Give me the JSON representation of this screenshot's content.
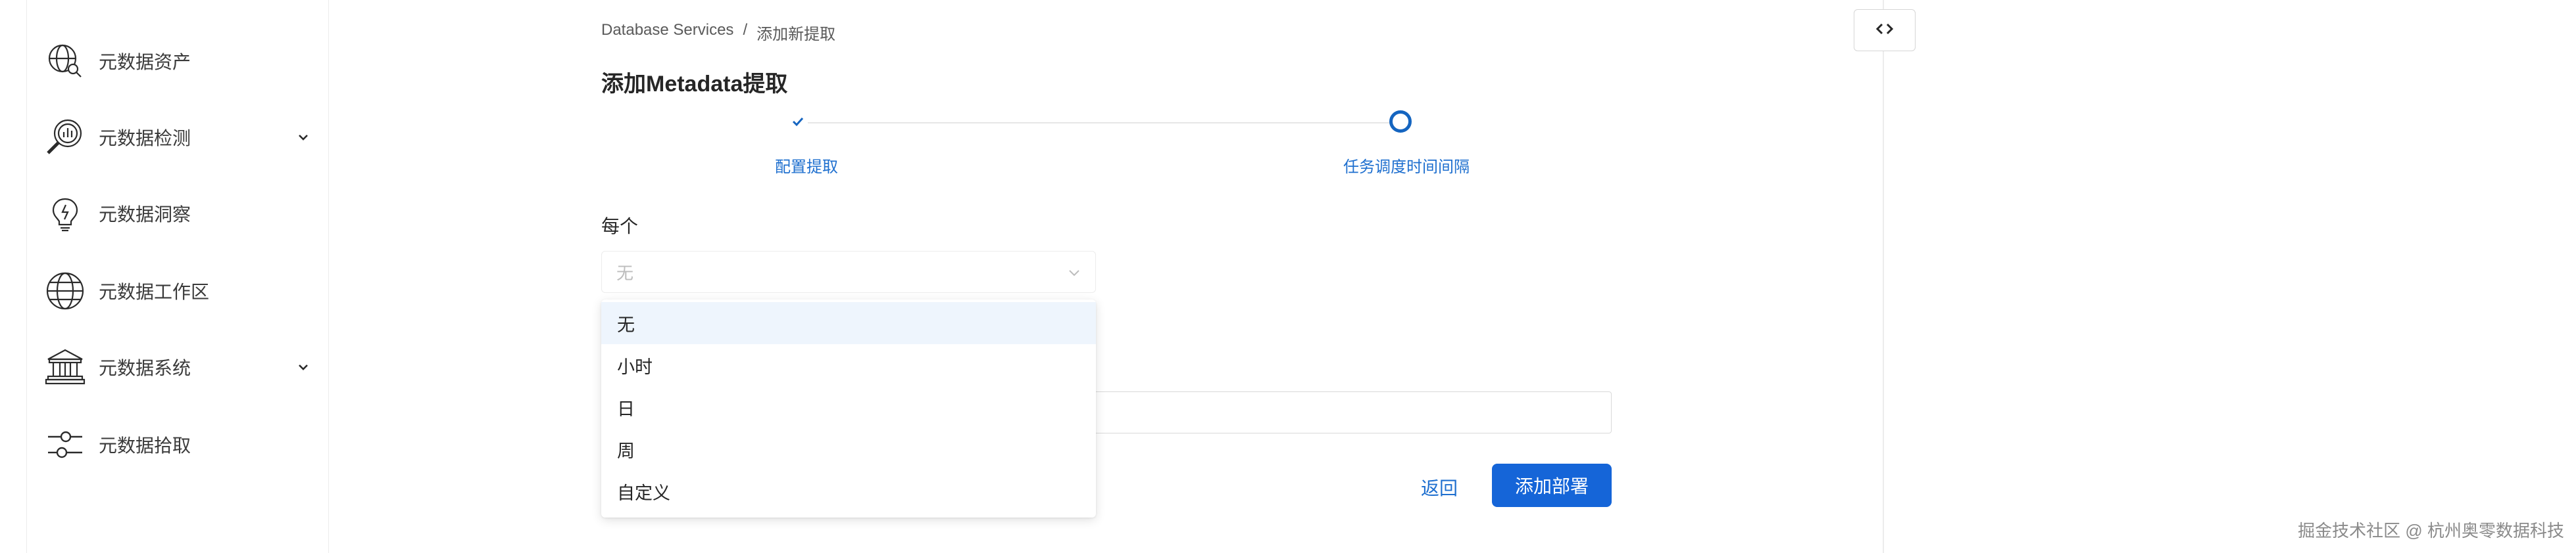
{
  "sidebar": {
    "items": [
      {
        "label": "元数据资产",
        "icon": "globe-search-icon",
        "expandable": false
      },
      {
        "label": "元数据检测",
        "icon": "magnifier-chart-icon",
        "expandable": true
      },
      {
        "label": "元数据洞察",
        "icon": "lightbulb-icon",
        "expandable": false
      },
      {
        "label": "元数据工作区",
        "icon": "globe-icon",
        "expandable": false
      },
      {
        "label": "元数据系统",
        "icon": "bank-icon",
        "expandable": true
      },
      {
        "label": "元数据拾取",
        "icon": "sliders-icon",
        "expandable": false
      }
    ]
  },
  "breadcrumb": {
    "root": "Database Services",
    "separator": "/",
    "current": "添加新提取"
  },
  "page": {
    "title": "添加Metadata提取"
  },
  "stepper": {
    "steps": [
      {
        "label": "配置提取",
        "status": "done"
      },
      {
        "label": "任务调度时间间隔",
        "status": "current"
      }
    ]
  },
  "form": {
    "every_label": "每个",
    "select_value": "无",
    "options": [
      "无",
      "小时",
      "日",
      "周",
      "自定义"
    ],
    "selected_option": "无"
  },
  "actions": {
    "back_label": "返回",
    "submit_label": "添加部署"
  },
  "watermark": "掘金技术社区 @ 杭州奥零数据科技",
  "colors": {
    "accent": "#1565d8",
    "link": "#1e6fcf",
    "selected_bg": "#eef5fd"
  }
}
